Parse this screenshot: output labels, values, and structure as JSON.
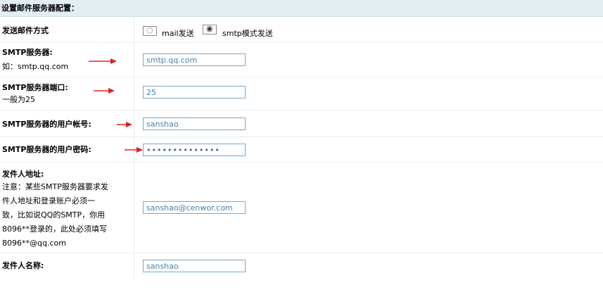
{
  "header": {
    "title": "设置邮件服务器配置："
  },
  "send_method": {
    "label": "发送邮件方式",
    "options": [
      {
        "label": "mail发送",
        "checked": false
      },
      {
        "label": "smtp模式发送",
        "checked": true
      }
    ]
  },
  "smtp_server": {
    "label": "SMTP服务器:",
    "hint": "如：smtp.qq.com",
    "value": "smtp.qq.com"
  },
  "smtp_port": {
    "label": "SMTP服务器端口:",
    "hint": "一般为25",
    "value": "25"
  },
  "smtp_user": {
    "label": "SMTP服务器的用户帐号:",
    "value": "sanshao"
  },
  "smtp_password": {
    "label": "SMTP服务器的用户密码:",
    "value": "passwordpasswo"
  },
  "sender_address": {
    "label": "发件人地址:",
    "note_lines": [
      "注意：某些SMTP服务器要求发",
      "件人地址和登录账户必须一",
      "致，比如说QQ的SMTP，你用",
      "8096**登录的，此处必须填写",
      "8096**@qq.com"
    ],
    "value": "sanshao@cenwor.com"
  },
  "sender_name": {
    "label": "发件人名称:",
    "value": "sanshao"
  },
  "colors": {
    "arrow": "#e02020",
    "input_border": "#7aa7c7",
    "header_bg": "#e3eef3"
  }
}
